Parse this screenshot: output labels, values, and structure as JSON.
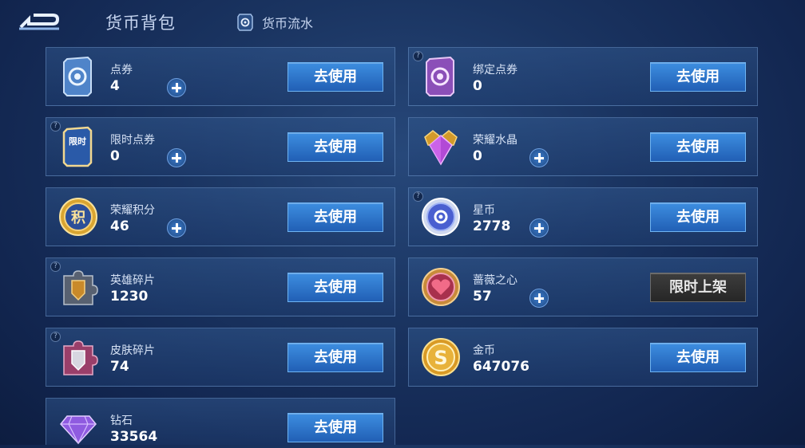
{
  "header": {
    "title": "货币背包",
    "flow_label": "货币流水"
  },
  "cards": [
    {
      "name": "点券",
      "value": "4",
      "button": "去使用"
    },
    {
      "name": "绑定点券",
      "value": "0",
      "button": "去使用"
    },
    {
      "name": "限时点券",
      "value": "0",
      "button": "去使用",
      "icon_text": "限时"
    },
    {
      "name": "荣耀水晶",
      "value": "0",
      "button": "去使用"
    },
    {
      "name": "荣耀积分",
      "value": "46",
      "button": "去使用",
      "icon_text": "积"
    },
    {
      "name": "星币",
      "value": "2778",
      "button": "去使用"
    },
    {
      "name": "英雄碎片",
      "value": "1230",
      "button": "去使用"
    },
    {
      "name": "蔷薇之心",
      "value": "57",
      "button": "限时上架"
    },
    {
      "name": "皮肤碎片",
      "value": "74",
      "button": "去使用"
    },
    {
      "name": "金币",
      "value": "647076",
      "button": "去使用",
      "icon_text": "S"
    },
    {
      "name": "钻石",
      "value": "33564",
      "button": "去使用"
    }
  ],
  "help_mark": "?",
  "colors": {
    "button_blue": "#2f78cc",
    "button_gray": "#2e2e2e",
    "background": "#1a3461"
  }
}
